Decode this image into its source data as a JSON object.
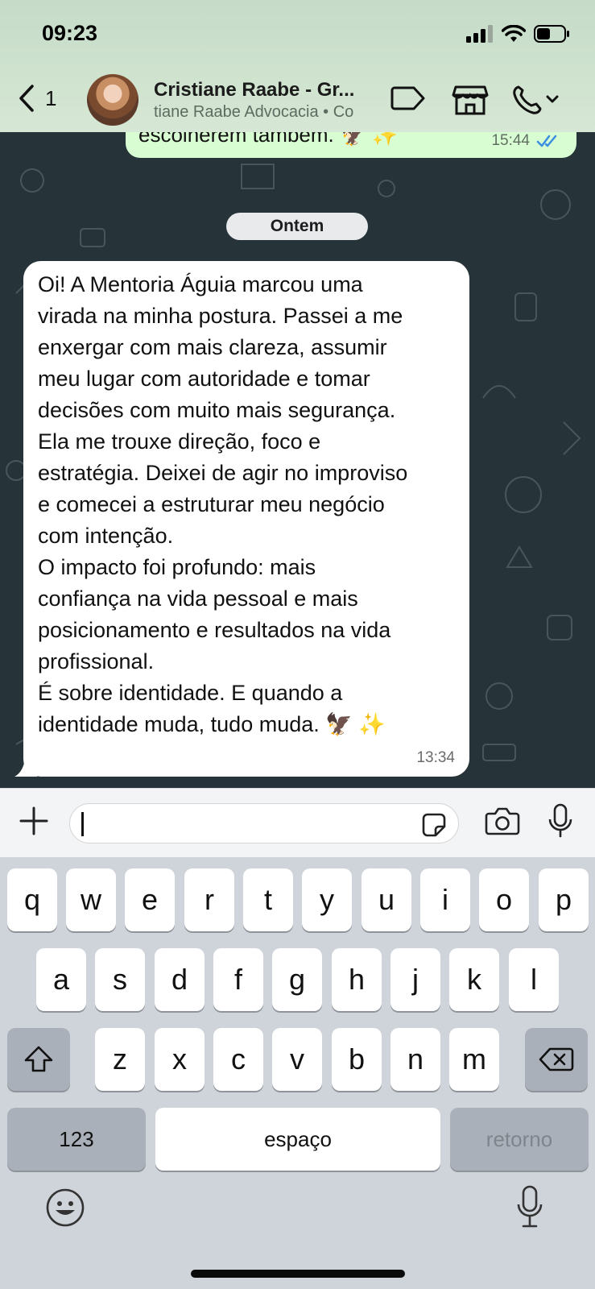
{
  "status_bar": {
    "time": "09:23"
  },
  "header": {
    "back_count": "1",
    "contact_name": "Cristiane Raabe - Gr...",
    "contact_subtitle": "tiane Raabe Advocacia  • Co"
  },
  "chat": {
    "previous_message": {
      "text": "escolherem também. 🦅 ✨",
      "time": "15:44"
    },
    "date_separator": "Ontem",
    "message": {
      "lines": [
        "Oi!  A Mentoria Águia marcou uma",
        "virada na minha postura. Passei a me",
        "enxergar com mais clareza, assumir",
        "meu lugar com autoridade e tomar",
        "decisões com muito mais segurança.",
        "Ela me trouxe direção, foco e",
        "estratégia. Deixei de agir no improviso",
        "e comecei a estruturar meu negócio",
        "com intenção.",
        "O impacto foi profundo: mais",
        "confiança na vida pessoal e mais",
        "posicionamento e resultados na vida",
        "profissional.",
        "É sobre identidade. E quando a",
        "identidade muda, tudo muda. 🦅 ✨"
      ],
      "time": "13:34"
    }
  },
  "keyboard": {
    "row1": [
      "q",
      "w",
      "e",
      "r",
      "t",
      "y",
      "u",
      "i",
      "o",
      "p"
    ],
    "row2": [
      "a",
      "s",
      "d",
      "f",
      "g",
      "h",
      "j",
      "k",
      "l"
    ],
    "row3": [
      "z",
      "x",
      "c",
      "v",
      "b",
      "n",
      "m"
    ],
    "numbers_label": "123",
    "space_label": "espaço",
    "return_label": "retorno"
  },
  "colors": {
    "header_bg": "#cfe3cf",
    "chat_bg": "#26343a",
    "outgoing_bubble": "#d9fdd3",
    "incoming_bubble": "#ffffff",
    "read_ticks": "#3b8fe0",
    "keyboard_bg": "#cfd3da"
  }
}
